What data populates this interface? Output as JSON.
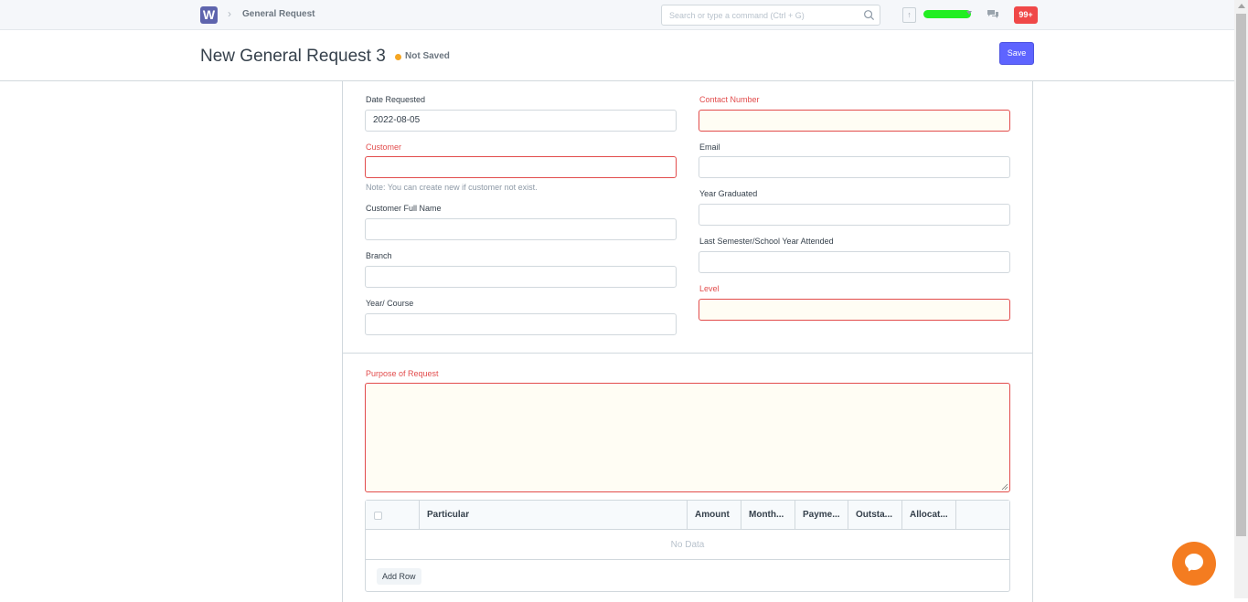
{
  "topbar": {
    "logo_letter": "W",
    "breadcrumb": "General Request",
    "search_placeholder": "Search or type a command (Ctrl + G)",
    "notification_count": "99+"
  },
  "header": {
    "title": "New General Request 3",
    "status": "Not Saved",
    "save_label": "Save"
  },
  "form": {
    "date_requested": {
      "label": "Date Requested",
      "value": "2022-08-05"
    },
    "customer": {
      "label": "Customer",
      "value": "",
      "note": "Note: You can create new if customer not exist."
    },
    "customer_full_name": {
      "label": "Customer Full Name",
      "value": ""
    },
    "branch": {
      "label": "Branch",
      "value": ""
    },
    "year_course": {
      "label": "Year/ Course",
      "value": ""
    },
    "contact_number": {
      "label": "Contact Number",
      "value": ""
    },
    "email": {
      "label": "Email",
      "value": ""
    },
    "year_graduated": {
      "label": "Year Graduated",
      "value": ""
    },
    "last_semester": {
      "label": "Last Semester/School Year Attended",
      "value": ""
    },
    "level": {
      "label": "Level",
      "value": ""
    },
    "purpose": {
      "label": "Purpose of Request",
      "value": ""
    }
  },
  "table": {
    "columns": [
      "Particular",
      "Amount",
      "Month...",
      "Payme...",
      "Outsta...",
      "Allocat..."
    ],
    "empty_text": "No Data",
    "add_row_label": "Add Row"
  },
  "colors": {
    "primary": "#5e64ff",
    "required": "#e24c4c",
    "notification": "#f04848",
    "chat_widget": "#f47c20",
    "status_dot": "#f5a623"
  }
}
